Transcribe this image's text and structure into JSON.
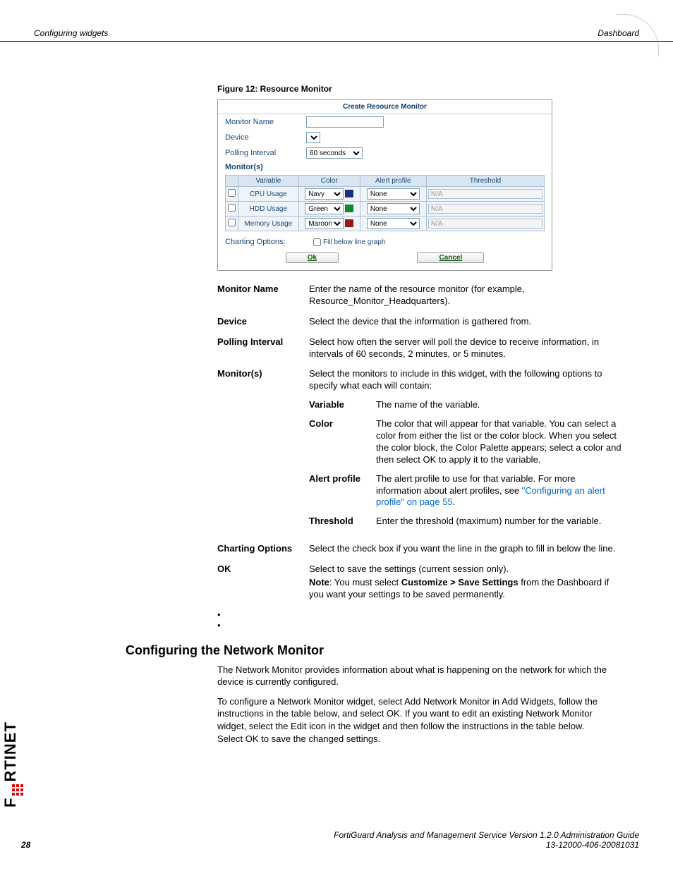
{
  "header": {
    "left": "Configuring widgets",
    "right": "Dashboard"
  },
  "figure_caption": "Figure 12: Resource Monitor",
  "dialog": {
    "title": "Create Resource Monitor",
    "monitor_name_label": "Monitor Name",
    "device_label": "Device",
    "polling_label": "Polling Interval",
    "polling_value": "60 seconds",
    "monitors_label": "Monitor(s)",
    "headers": {
      "variable": "Variable",
      "color": "Color",
      "alert": "Alert profile",
      "threshold": "Threshold"
    },
    "rows": [
      {
        "variable": "CPU Usage",
        "color": "Navy",
        "alert": "None",
        "threshold": "N/A"
      },
      {
        "variable": "HDD Usage",
        "color": "Green",
        "alert": "None",
        "threshold": "N/A"
      },
      {
        "variable": "Memory Usage",
        "color": "Maroon",
        "alert": "None",
        "threshold": "N/A"
      }
    ],
    "charting_label": "Charting Options:",
    "fill_label": "Fill below line graph",
    "ok": "Ok",
    "cancel": "Cancel"
  },
  "descriptions": {
    "monitor_name": {
      "label": "Monitor Name",
      "text": "Enter the name of the resource monitor (for example, Resource_Monitor_Headquarters)."
    },
    "device": {
      "label": "Device",
      "text": "Select the device that the information is gathered from."
    },
    "polling": {
      "label": "Polling Interval",
      "text": "Select how often the server will poll the device to receive information, in intervals of 60 seconds, 2 minutes, or 5 minutes."
    },
    "monitors": {
      "label": "Monitor(s)",
      "intro": "Select the monitors to include in this widget, with the following options to specify what each will contain:",
      "variable": {
        "label": "Variable",
        "text": "The name of the variable."
      },
      "color": {
        "label": "Color",
        "text": "The color that will appear for that variable. You can select a color from either the list or the color block. When you select the color block, the Color Palette appears; select a color and then select OK to apply it to the variable."
      },
      "alert": {
        "label": "Alert profile",
        "text_before": "The alert profile to use for that variable. For more information about alert profiles, see ",
        "link": "\"Configuring an alert profile\" on page 55",
        "text_after": "."
      },
      "threshold": {
        "label": "Threshold",
        "text": "Enter the threshold (maximum) number for the variable."
      }
    },
    "charting": {
      "label": "Charting Options",
      "text": "Select the check box if you want the line in the graph to fill in below the line."
    },
    "ok": {
      "label": "OK",
      "line1": "Select to save the settings (current session only).",
      "note_prefix": "Note",
      "note_mid": ": You must select ",
      "note_bold": "Customize > Save Settings",
      "note_suffix": " from the Dashboard if you want your settings to be saved permanently."
    }
  },
  "section_heading": "Configuring the Network Monitor",
  "para1": "The Network Monitor provides information about what is happening on the network for which the device is currently configured.",
  "para2": "To configure a Network Monitor widget, select Add Network Monitor in Add Widgets, follow the instructions in the table below, and select OK. If you want to edit an existing Network Monitor widget, select the Edit icon in the widget and then follow the instructions in the table below. Select OK to save the changed settings.",
  "footer": {
    "line1": "FortiGuard Analysis and Management Service Version 1.2.0 Administration Guide",
    "line2": "13-12000-406-20081031",
    "page": "28"
  },
  "logo_text_a": "F",
  "logo_text_b": "RTINET"
}
